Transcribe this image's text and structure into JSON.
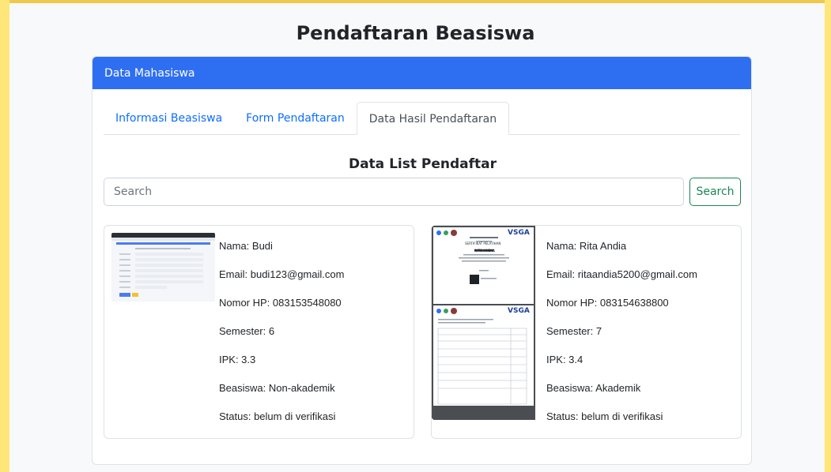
{
  "page": {
    "title": "Pendaftaran Beasiswa"
  },
  "card": {
    "header": "Data Mahasiswa"
  },
  "tabs": [
    {
      "label": "Informasi Beasiswa",
      "active": false
    },
    {
      "label": "Form Pendaftaran",
      "active": false
    },
    {
      "label": "Data Hasil Pendaftaran",
      "active": true
    }
  ],
  "list": {
    "title": "Data List Pendaftar",
    "search": {
      "placeholder": "Search",
      "value": "",
      "button_label": "Search"
    },
    "entries": [
      {
        "thumbnail": "screenshot-thumbnail",
        "nama": "Nama: Budi",
        "email": "Email: budi123@gmail.com",
        "hp": "Nomor HP: 083153548080",
        "semester": "Semester: 6",
        "ipk": "IPK: 3.3",
        "beasiswa": "Beasiswa: Non-akademik",
        "status": "Status: belum di verifikasi"
      },
      {
        "thumbnail": "certificate-thumbnail",
        "cert_brand": "VSGA",
        "cert_title": "SERTIFIKAT PELATIHAN",
        "cert_name": "RITA ANDIA",
        "nama": "Nama: Rita Andia",
        "email": "Email: ritaandia5200@gmail.com",
        "hp": "Nomor HP: 083154638800",
        "semester": "Semester: 7",
        "ipk": "IPK: 3.4",
        "beasiswa": "Beasiswa: Akademik",
        "status": "Status: belum di verifikasi"
      }
    ]
  },
  "colors": {
    "header_bg": "#2e6ff2",
    "tab_link": "#0d6efd",
    "search_button": "#198754",
    "frame": "#ffe67a"
  }
}
